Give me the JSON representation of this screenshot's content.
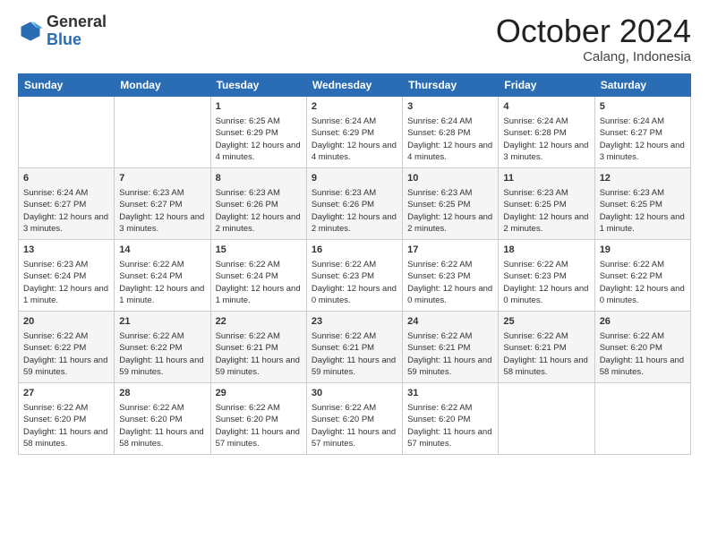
{
  "logo": {
    "general": "General",
    "blue": "Blue"
  },
  "header": {
    "month": "October 2024",
    "location": "Calang, Indonesia"
  },
  "weekdays": [
    "Sunday",
    "Monday",
    "Tuesday",
    "Wednesday",
    "Thursday",
    "Friday",
    "Saturday"
  ],
  "weeks": [
    [
      {
        "day": "",
        "content": ""
      },
      {
        "day": "",
        "content": ""
      },
      {
        "day": "1",
        "content": "Sunrise: 6:25 AM\nSunset: 6:29 PM\nDaylight: 12 hours and 4 minutes."
      },
      {
        "day": "2",
        "content": "Sunrise: 6:24 AM\nSunset: 6:29 PM\nDaylight: 12 hours and 4 minutes."
      },
      {
        "day": "3",
        "content": "Sunrise: 6:24 AM\nSunset: 6:28 PM\nDaylight: 12 hours and 4 minutes."
      },
      {
        "day": "4",
        "content": "Sunrise: 6:24 AM\nSunset: 6:28 PM\nDaylight: 12 hours and 3 minutes."
      },
      {
        "day": "5",
        "content": "Sunrise: 6:24 AM\nSunset: 6:27 PM\nDaylight: 12 hours and 3 minutes."
      }
    ],
    [
      {
        "day": "6",
        "content": "Sunrise: 6:24 AM\nSunset: 6:27 PM\nDaylight: 12 hours and 3 minutes."
      },
      {
        "day": "7",
        "content": "Sunrise: 6:23 AM\nSunset: 6:27 PM\nDaylight: 12 hours and 3 minutes."
      },
      {
        "day": "8",
        "content": "Sunrise: 6:23 AM\nSunset: 6:26 PM\nDaylight: 12 hours and 2 minutes."
      },
      {
        "day": "9",
        "content": "Sunrise: 6:23 AM\nSunset: 6:26 PM\nDaylight: 12 hours and 2 minutes."
      },
      {
        "day": "10",
        "content": "Sunrise: 6:23 AM\nSunset: 6:25 PM\nDaylight: 12 hours and 2 minutes."
      },
      {
        "day": "11",
        "content": "Sunrise: 6:23 AM\nSunset: 6:25 PM\nDaylight: 12 hours and 2 minutes."
      },
      {
        "day": "12",
        "content": "Sunrise: 6:23 AM\nSunset: 6:25 PM\nDaylight: 12 hours and 1 minute."
      }
    ],
    [
      {
        "day": "13",
        "content": "Sunrise: 6:23 AM\nSunset: 6:24 PM\nDaylight: 12 hours and 1 minute."
      },
      {
        "day": "14",
        "content": "Sunrise: 6:22 AM\nSunset: 6:24 PM\nDaylight: 12 hours and 1 minute."
      },
      {
        "day": "15",
        "content": "Sunrise: 6:22 AM\nSunset: 6:24 PM\nDaylight: 12 hours and 1 minute."
      },
      {
        "day": "16",
        "content": "Sunrise: 6:22 AM\nSunset: 6:23 PM\nDaylight: 12 hours and 0 minutes."
      },
      {
        "day": "17",
        "content": "Sunrise: 6:22 AM\nSunset: 6:23 PM\nDaylight: 12 hours and 0 minutes."
      },
      {
        "day": "18",
        "content": "Sunrise: 6:22 AM\nSunset: 6:23 PM\nDaylight: 12 hours and 0 minutes."
      },
      {
        "day": "19",
        "content": "Sunrise: 6:22 AM\nSunset: 6:22 PM\nDaylight: 12 hours and 0 minutes."
      }
    ],
    [
      {
        "day": "20",
        "content": "Sunrise: 6:22 AM\nSunset: 6:22 PM\nDaylight: 11 hours and 59 minutes."
      },
      {
        "day": "21",
        "content": "Sunrise: 6:22 AM\nSunset: 6:22 PM\nDaylight: 11 hours and 59 minutes."
      },
      {
        "day": "22",
        "content": "Sunrise: 6:22 AM\nSunset: 6:21 PM\nDaylight: 11 hours and 59 minutes."
      },
      {
        "day": "23",
        "content": "Sunrise: 6:22 AM\nSunset: 6:21 PM\nDaylight: 11 hours and 59 minutes."
      },
      {
        "day": "24",
        "content": "Sunrise: 6:22 AM\nSunset: 6:21 PM\nDaylight: 11 hours and 59 minutes."
      },
      {
        "day": "25",
        "content": "Sunrise: 6:22 AM\nSunset: 6:21 PM\nDaylight: 11 hours and 58 minutes."
      },
      {
        "day": "26",
        "content": "Sunrise: 6:22 AM\nSunset: 6:20 PM\nDaylight: 11 hours and 58 minutes."
      }
    ],
    [
      {
        "day": "27",
        "content": "Sunrise: 6:22 AM\nSunset: 6:20 PM\nDaylight: 11 hours and 58 minutes."
      },
      {
        "day": "28",
        "content": "Sunrise: 6:22 AM\nSunset: 6:20 PM\nDaylight: 11 hours and 58 minutes."
      },
      {
        "day": "29",
        "content": "Sunrise: 6:22 AM\nSunset: 6:20 PM\nDaylight: 11 hours and 57 minutes."
      },
      {
        "day": "30",
        "content": "Sunrise: 6:22 AM\nSunset: 6:20 PM\nDaylight: 11 hours and 57 minutes."
      },
      {
        "day": "31",
        "content": "Sunrise: 6:22 AM\nSunset: 6:20 PM\nDaylight: 11 hours and 57 minutes."
      },
      {
        "day": "",
        "content": ""
      },
      {
        "day": "",
        "content": ""
      }
    ]
  ]
}
